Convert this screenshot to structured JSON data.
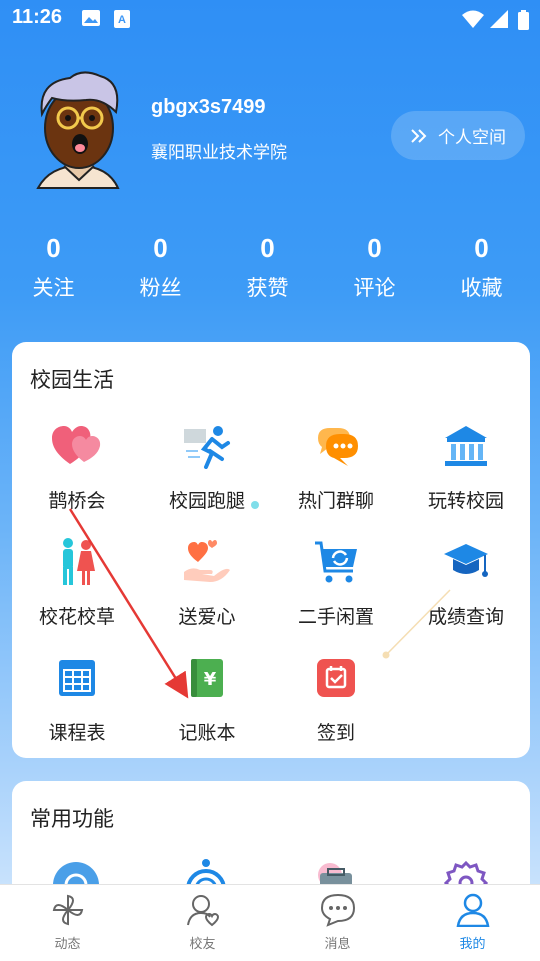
{
  "status_bar": {
    "time": "11:26",
    "icons": [
      "image-icon",
      "accessibility-a-icon",
      "wifi-icon",
      "signal-icon",
      "battery-icon"
    ]
  },
  "profile": {
    "username": "gbgx3s7499",
    "school": "襄阳职业技术学院",
    "space_button": "个人空间"
  },
  "stats": [
    {
      "value": "0",
      "label": "关注"
    },
    {
      "value": "0",
      "label": "粉丝"
    },
    {
      "value": "0",
      "label": "获赞"
    },
    {
      "value": "0",
      "label": "评论"
    },
    {
      "value": "0",
      "label": "收藏"
    }
  ],
  "campus_life": {
    "title": "校园生活",
    "items": [
      {
        "label": "鹊桥会",
        "icon": "hearts-icon"
      },
      {
        "label": "校园跑腿",
        "icon": "runner-icon"
      },
      {
        "label": "热门群聊",
        "icon": "chat-bubbles-icon"
      },
      {
        "label": "玩转校园",
        "icon": "campus-building-icon"
      },
      {
        "label": "校花校草",
        "icon": "couple-icon"
      },
      {
        "label": "送爱心",
        "icon": "hand-heart-icon"
      },
      {
        "label": "二手闲置",
        "icon": "cart-icon"
      },
      {
        "label": "成绩查询",
        "icon": "graduation-cap-icon"
      },
      {
        "label": "课程表",
        "icon": "calendar-grid-icon"
      },
      {
        "label": "记账本",
        "icon": "ledger-icon"
      },
      {
        "label": "签到",
        "icon": "checkin-calendar-icon"
      }
    ]
  },
  "common_functions": {
    "title": "常用功能"
  },
  "bottom_nav": [
    {
      "label": "动态",
      "icon": "pinwheel-icon"
    },
    {
      "label": "校友",
      "icon": "user-heart-icon"
    },
    {
      "label": "消息",
      "icon": "message-icon"
    },
    {
      "label": "我的",
      "icon": "person-icon",
      "active": true
    }
  ],
  "colors": {
    "accent": "#1e88e5",
    "annotation_arrow": "#e53935"
  }
}
